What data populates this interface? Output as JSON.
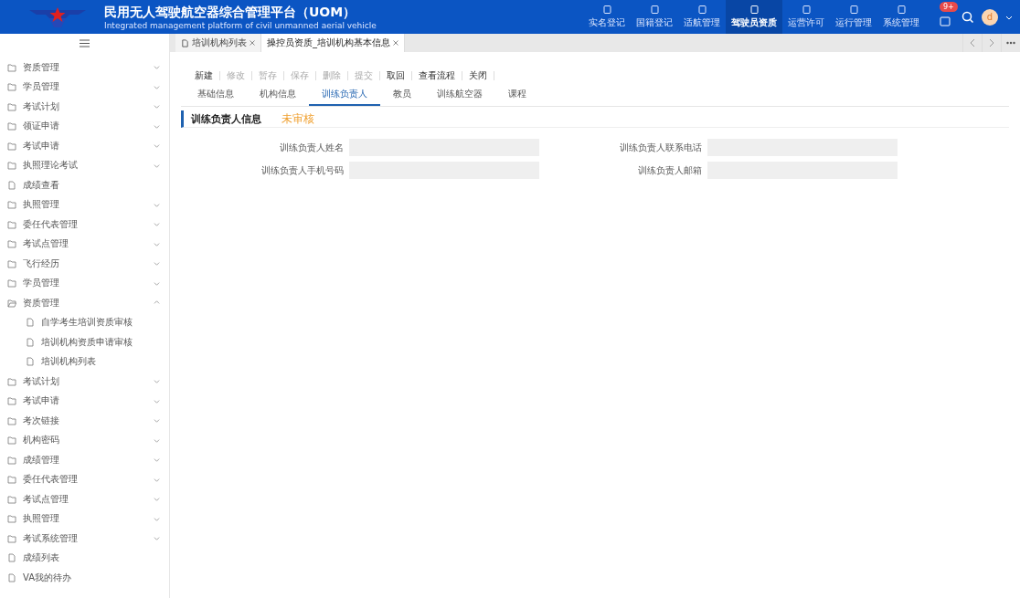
{
  "header": {
    "title": "民用无人驾驶航空器综合管理平台（UOM）",
    "subtitle": "Integrated management platform of civil unmanned aerial vehicle",
    "nav": [
      {
        "label": "实名登记",
        "selected": false
      },
      {
        "label": "国籍登记",
        "selected": false
      },
      {
        "label": "适航管理",
        "selected": false
      },
      {
        "label": "驾驶员资质",
        "selected": true
      },
      {
        "label": "运营许可",
        "selected": false
      },
      {
        "label": "运行管理",
        "selected": false
      },
      {
        "label": "系统管理",
        "selected": false
      }
    ],
    "badge": "9+",
    "avatar": "d"
  },
  "tabs": [
    {
      "label": "培训机构列表",
      "selected": false
    },
    {
      "label": "操控员资质_培训机构基本信息",
      "selected": true
    }
  ],
  "sidebar": {
    "items": [
      {
        "kind": "group",
        "label": "资质管理",
        "expanded": false
      },
      {
        "kind": "group",
        "label": "学员管理",
        "expanded": false
      },
      {
        "kind": "group",
        "label": "考试计划",
        "expanded": false
      },
      {
        "kind": "group",
        "label": "领证申请",
        "expanded": false
      },
      {
        "kind": "group",
        "label": "考试申请",
        "expanded": false
      },
      {
        "kind": "group",
        "label": "执照理论考试",
        "expanded": false
      },
      {
        "kind": "page",
        "label": "成绩查看"
      },
      {
        "kind": "group",
        "label": "执照管理",
        "expanded": false
      },
      {
        "kind": "group",
        "label": "委任代表管理",
        "expanded": false
      },
      {
        "kind": "group",
        "label": "考试点管理",
        "expanded": false
      },
      {
        "kind": "group",
        "label": "飞行经历",
        "expanded": false
      },
      {
        "kind": "group",
        "label": "学员管理",
        "expanded": false
      },
      {
        "kind": "group",
        "label": "资质管理",
        "expanded": true,
        "children": [
          {
            "kind": "page",
            "label": "自学考生培训资质审核"
          },
          {
            "kind": "page",
            "label": "培训机构资质申请审核"
          },
          {
            "kind": "page",
            "label": "培训机构列表"
          }
        ]
      },
      {
        "kind": "group",
        "label": "考试计划",
        "expanded": false
      },
      {
        "kind": "group",
        "label": "考试申请",
        "expanded": false
      },
      {
        "kind": "group",
        "label": "考次链接",
        "expanded": false
      },
      {
        "kind": "group",
        "label": "机构密码",
        "expanded": false
      },
      {
        "kind": "group",
        "label": "成绩管理",
        "expanded": false
      },
      {
        "kind": "group",
        "label": "委任代表管理",
        "expanded": false
      },
      {
        "kind": "group",
        "label": "考试点管理",
        "expanded": false
      },
      {
        "kind": "group",
        "label": "执照管理",
        "expanded": false
      },
      {
        "kind": "group",
        "label": "考试系统管理",
        "expanded": false
      },
      {
        "kind": "page",
        "label": "成绩列表"
      },
      {
        "kind": "page",
        "label": "VA我的待办"
      }
    ]
  },
  "toolbar": [
    {
      "label": "新建",
      "disabled": false
    },
    {
      "label": "修改",
      "disabled": true
    },
    {
      "label": "暂存",
      "disabled": true
    },
    {
      "label": "保存",
      "disabled": true
    },
    {
      "label": "删除",
      "disabled": true
    },
    {
      "label": "提交",
      "disabled": true
    },
    {
      "label": "取回",
      "disabled": false
    },
    {
      "label": "查看流程",
      "disabled": false
    },
    {
      "label": "关闭",
      "disabled": false
    }
  ],
  "subtabs": [
    {
      "label": "基础信息",
      "selected": false
    },
    {
      "label": "机构信息",
      "selected": false
    },
    {
      "label": "训练负责人",
      "selected": true
    },
    {
      "label": "教员",
      "selected": false
    },
    {
      "label": "训练航空器",
      "selected": false
    },
    {
      "label": "课程",
      "selected": false
    }
  ],
  "section": {
    "title": "训练负责人信息",
    "status": "未审核"
  },
  "fields": [
    {
      "label": "训练负责人姓名"
    },
    {
      "label": "训练负责人联系电话"
    },
    {
      "label": "训练负责人手机号码"
    },
    {
      "label": "训练负责人邮箱"
    }
  ]
}
